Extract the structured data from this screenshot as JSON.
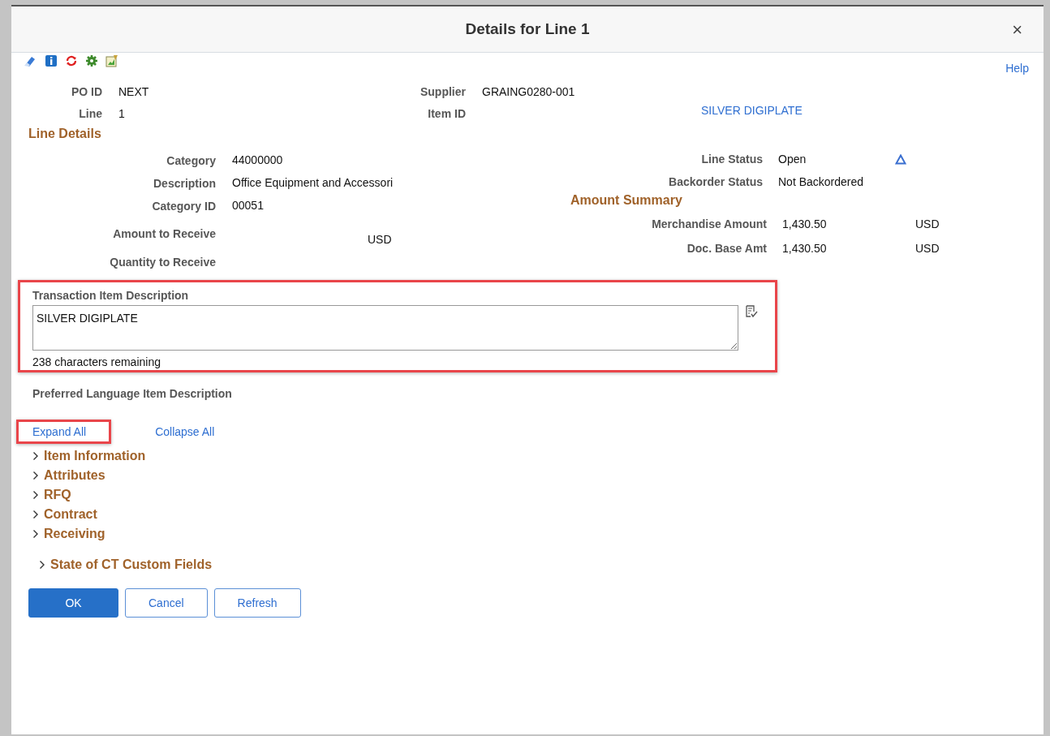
{
  "dialog": {
    "title": "Details for Line 1",
    "close": "×"
  },
  "help_link": "Help",
  "header_fields": [
    {
      "label": "PO ID",
      "value": "NEXT"
    },
    {
      "label": "Supplier",
      "value": "GRAING0280-001"
    },
    {
      "label": "Line",
      "value": "1"
    },
    {
      "label": "Item ID",
      "link": "SILVER DIGIPLATE"
    }
  ],
  "line_details": {
    "title": "Line Details",
    "left_fields": [
      {
        "label": "Category",
        "value": "44000000"
      },
      {
        "label": "Description",
        "value": "Office Equipment and Accessori"
      },
      {
        "label": "Category ID",
        "value": "00051"
      },
      {
        "label": "Amount to Receive",
        "unit": "USD"
      },
      {
        "label": "Quantity to Receive"
      }
    ],
    "status_fields": [
      {
        "label": "Line Status",
        "value": "Open",
        "icon": true
      },
      {
        "label": "Backorder Status",
        "value": "Not Backordered"
      }
    ],
    "amount_summary": {
      "title": "Amount Summary",
      "fields": [
        {
          "label": "Merchandise Amount",
          "value": "1,430.50",
          "unit": "USD"
        },
        {
          "label": "Doc. Base Amt",
          "value": "1,430.50",
          "unit": "USD"
        }
      ]
    }
  },
  "transaction_description": {
    "label": "Transaction Item Description",
    "value": "SILVER DIGIPLATE",
    "counter": "238 characters remaining"
  },
  "preferred_language_label": "Preferred Language Item Description",
  "expand_all": "Expand All",
  "collapse_all": "Collapse All",
  "sections": [
    {
      "label": "Item Information",
      "expanded": false
    },
    {
      "label": "Attributes",
      "expanded": false
    },
    {
      "label": "RFQ",
      "expanded": false
    },
    {
      "label": "Contract",
      "expanded": false
    },
    {
      "label": "Receiving",
      "expanded": false
    }
  ],
  "custom_section": {
    "label": "State of CT Custom Fields",
    "expanded": false
  },
  "buttons": [
    {
      "label": "OK",
      "kind": "primary"
    },
    {
      "label": "Cancel",
      "kind": "secondary"
    },
    {
      "label": "Refresh",
      "kind": "secondary"
    }
  ]
}
